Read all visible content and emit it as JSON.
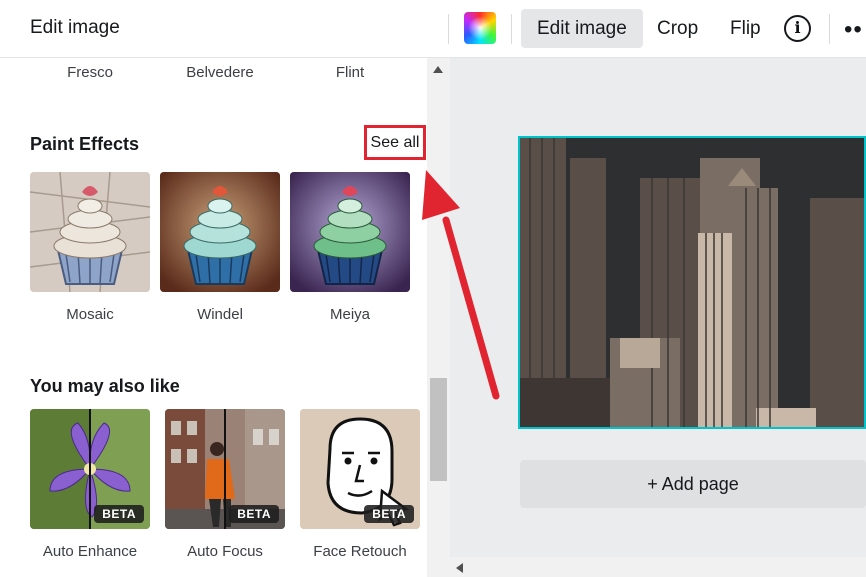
{
  "header": {
    "panel_title": "Edit image",
    "toolbar": {
      "edit_image": "Edit image",
      "crop": "Crop",
      "flip": "Flip",
      "info_glyph": "i",
      "more_glyph": "••"
    }
  },
  "filters_row": [
    "Fresco",
    "Belvedere",
    "Flint"
  ],
  "paint_effects": {
    "title": "Paint Effects",
    "see_all": "See all",
    "items": [
      "Mosaic",
      "Windel",
      "Meiya"
    ]
  },
  "also_like": {
    "title": "You may also like",
    "items": [
      {
        "label": "Auto Enhance",
        "badge": "BETA"
      },
      {
        "label": "Auto Focus",
        "badge": "BETA"
      },
      {
        "label": "Face Retouch",
        "badge": "BETA"
      }
    ]
  },
  "canvas": {
    "add_page": "+ Add page"
  },
  "colors": {
    "selection": "#00c4cc",
    "annotation": "#e02530",
    "active_button": "#e4e6e8"
  }
}
